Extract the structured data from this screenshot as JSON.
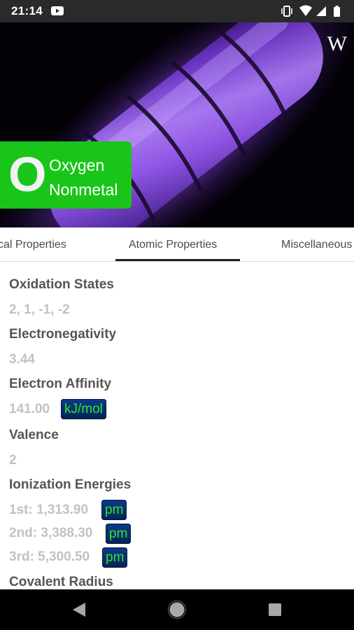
{
  "status_bar": {
    "time": "21:14",
    "icons": [
      "youtube-icon",
      "vibrate-icon",
      "wifi-icon",
      "signal-icon",
      "battery-icon"
    ]
  },
  "hero": {
    "logo_text": "W",
    "element": {
      "symbol": "O",
      "name": "Oxygen",
      "category": "Nonmetal",
      "color": "#19c518"
    }
  },
  "tabs": [
    {
      "label": "Physical Properties",
      "visible_text": "cal Properties"
    },
    {
      "label": "Atomic Properties",
      "selected": true
    },
    {
      "label": "Miscellaneous",
      "visible_text": "Miscellaneous"
    }
  ],
  "properties": {
    "oxidation_states": {
      "label": "Oxidation States",
      "value": "2, 1, -1, -2"
    },
    "electronegativity": {
      "label": "Electronegativity",
      "value": "3.44"
    },
    "electron_affinity": {
      "label": "Electron Affinity",
      "value": "141.00",
      "unit": "kJ/mol"
    },
    "valence": {
      "label": "Valence",
      "value": "2"
    },
    "ionization_energies": {
      "label": "Ionization Energies",
      "values": [
        {
          "text": "1st: 1,313.90",
          "unit": "pm"
        },
        {
          "text": "2nd: 3,388.30",
          "unit": "pm"
        },
        {
          "text": "3rd: 5,300.50",
          "unit": "pm"
        }
      ]
    },
    "covalent_radius": {
      "label": "Covalent Radius"
    }
  },
  "nav_bar": {
    "buttons": [
      "back",
      "home",
      "recents"
    ]
  },
  "colors": {
    "status_bar": "#2a2a2a",
    "element_card": "#19c518",
    "unit_badge": "#0b3b88",
    "unit_text": "#2ee62e",
    "heading_text": "#555555",
    "value_text": "#c2c2c2"
  }
}
